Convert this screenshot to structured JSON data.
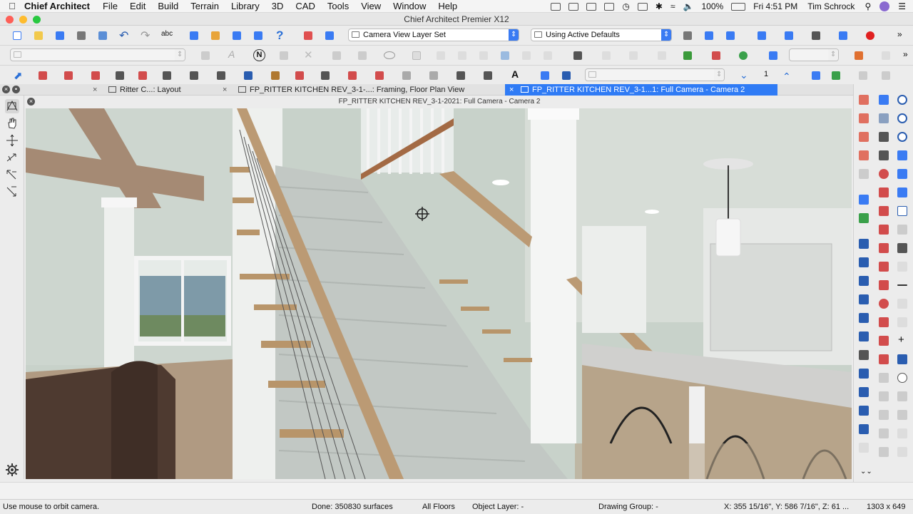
{
  "menubar": {
    "app_name": "Chief Architect",
    "items": [
      "File",
      "Edit",
      "Build",
      "Terrain",
      "Library",
      "3D",
      "CAD",
      "Tools",
      "View",
      "Window",
      "Help"
    ],
    "battery": "100%",
    "clock": "Fri 4:51 PM",
    "user": "Tim Schrock"
  },
  "window": {
    "title": "Chief Architect Premier X12"
  },
  "toolbar": {
    "layer_set": "Camera View Layer Set",
    "defaults_set": "Using Active Defaults",
    "floor_count": "1"
  },
  "tabs": [
    {
      "label": "Ritter C...: Layout",
      "active": false
    },
    {
      "label": "FP_RITTER KITCHEN REV_3-1-...: Framing, Floor Plan View",
      "active": false
    },
    {
      "label": "FP_RITTER KITCHEN REV_3-1...1: Full Camera - Camera 2",
      "active": true
    }
  ],
  "view": {
    "title": "FP_RITTER KITCHEN REV_3-1-2021: Full Camera - Camera 2"
  },
  "statusbar": {
    "hint": "Use mouse to orbit camera.",
    "progress": "Done:  350830 surfaces",
    "floors": "All Floors",
    "object_layer": "Object Layer: -",
    "drawing_group": "Drawing Group: -",
    "coords": "X: 355 15/16\", Y: 586 7/16\", Z: 61 ...",
    "size": "1303 x 649"
  },
  "colors": {
    "accent": "#2f7bf5",
    "wall": "#c9d4cc",
    "wood": "#b89a72",
    "carpet": "#c4cac6"
  }
}
